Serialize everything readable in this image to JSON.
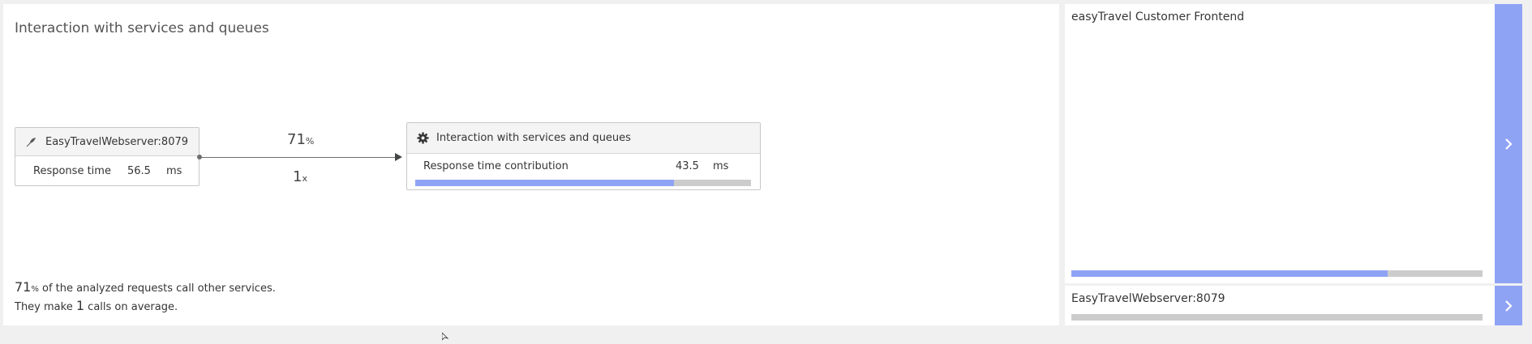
{
  "panel": {
    "title": "Interaction with services and queues"
  },
  "source_node": {
    "name": "EasyTravelWebserver:8079",
    "metric_label": "Response time",
    "metric_value": "56.5",
    "metric_unit": "ms",
    "icon": "feather-icon"
  },
  "edge": {
    "percent_value": "71",
    "percent_unit": "%",
    "calls_value": "1",
    "calls_unit": "x"
  },
  "target_node": {
    "name": "Interaction with services and queues",
    "metric_label": "Response time contribution",
    "metric_value": "43.5",
    "metric_unit": "ms",
    "icon": "gear-icon",
    "contribution_fraction": 0.77
  },
  "footer": {
    "line1_value": "71",
    "line1_unit": "%",
    "line1_text": "of the analyzed requests call other services.",
    "line2_prefix": "They make",
    "line2_value": "1",
    "line2_suffix": "calls on average."
  },
  "side_cards": [
    {
      "title": "easyTravel Customer Frontend",
      "bar_fraction": 0.77,
      "button_icon": "chevron-right-icon"
    },
    {
      "title": "EasyTravelWebserver:8079",
      "bar_fraction": 0.0,
      "button_icon": "chevron-right-icon"
    }
  ],
  "colors": {
    "accent": "#8fa3f5",
    "track": "#cccccc",
    "background": "#f0f0f0"
  }
}
